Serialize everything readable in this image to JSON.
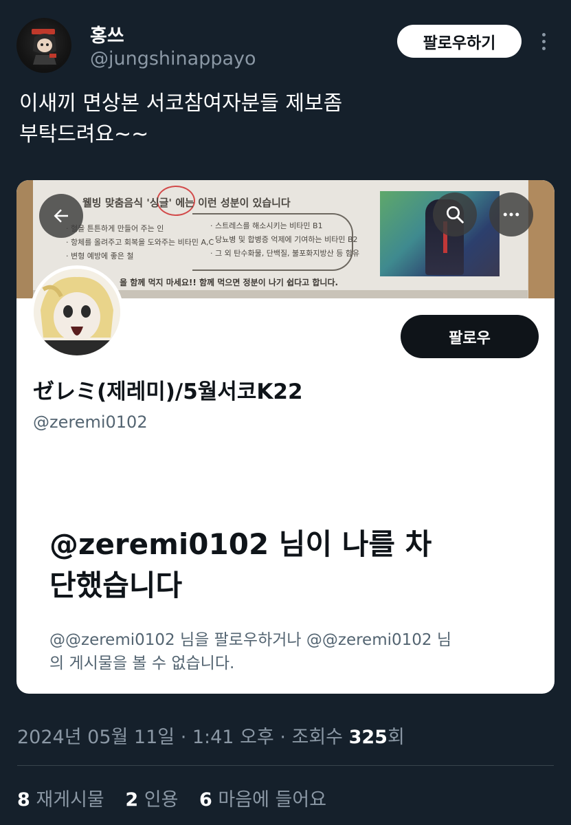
{
  "author": {
    "display_name": "홍쓰",
    "handle": "@jungshinappayo",
    "avatar_icon": "anime-avatar-icon"
  },
  "header": {
    "follow_label": "팔로우하기",
    "more_icon": "more-vertical-icon"
  },
  "tweet": {
    "text_line1": "이새끼 면상본 서코참여자분들 제보좀",
    "text_line2": "부탁드려요~~"
  },
  "embedded_screenshot": {
    "banner": {
      "title": "웰빙 맞춤음식 '싱글' 에는 이런 성분이 있습니다",
      "left_line1": "· 혈을 튼튼하게 만들어 주는 인",
      "left_line2": "· 항체를 올려주고 회복을 도와주는 비타민 A,C",
      "left_line3": "· 변형 예방에 좋은 철",
      "right_line1": "· 스트레스를 해소시키는 비타민 B1",
      "right_line2": "· 당뇨병 및 합병증 억제에 기여하는 비타민 B2",
      "right_line3": "· 그 외 탄수화물, 단백질, 불포화지방산 등 함유",
      "bottom": "을 함께 먹지 마세요!! 함께 먹으면 정분이 나기 쉽다고 합니다."
    },
    "back_icon": "arrow-left-icon",
    "search_icon": "search-icon",
    "more_icon": "more-horizontal-icon",
    "profile": {
      "follow_label": "팔로우",
      "name": "ゼレミ(제레미)/5월서코K22",
      "handle": "@zeremi0102"
    },
    "blocked": {
      "title_line1": "@zeremi0102 님이 나를 차",
      "title_line2": "단했습니다",
      "desc_line1": "@@zeremi0102 님을 팔로우하거나 @@zeremi0102 님",
      "desc_line2": "의 게시물을 볼 수 없습니다."
    }
  },
  "meta": {
    "timestamp": "2024년 05월 11일 · 1:41 오후 · 조회수 ",
    "views": "325",
    "views_suffix": "회"
  },
  "stats": {
    "reposts_count": "8",
    "reposts_label": "재게시물",
    "quotes_count": "2",
    "quotes_label": "인용",
    "likes_count": "6",
    "likes_label": "마음에 들어요"
  },
  "colors": {
    "background": "#15202b",
    "secondary_text": "#8b98a5",
    "card_background": "#ffffff",
    "dark_button": "#0f1419"
  }
}
